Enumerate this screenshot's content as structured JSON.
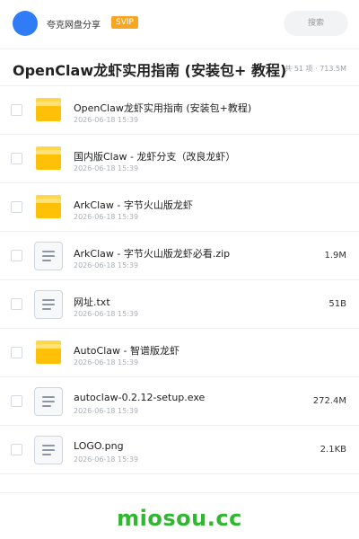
{
  "header": {
    "owner_name": "夸克网盘分享",
    "badge": "SVIP",
    "search_placeholder": "搜索"
  },
  "folder": {
    "title": "OpenClaw龙虾实用指南 (安装包+ 教程)",
    "summary": "共 51 项 · 713.5M"
  },
  "files": [
    {
      "name": "OpenClaw龙虾实用指南 (安装包+教程)",
      "date": "2026-06-18 15:39",
      "size": "",
      "type": "folder",
      "icon": "folder-icon"
    },
    {
      "name": "国内版Claw - 龙虾分支（改良龙虾）",
      "date": "2026-06-18 15:39",
      "size": "",
      "type": "folder",
      "icon": "folder-icon"
    },
    {
      "name": "ArkClaw - 字节火山版龙虾",
      "date": "2026-06-18 15:39",
      "size": "",
      "type": "folder",
      "icon": "folder-icon"
    },
    {
      "name": "ArkClaw - 字节火山版龙虾必看.zip",
      "date": "2026-06-18 15:39",
      "size": "1.9M",
      "type": "file",
      "icon": "file-icon"
    },
    {
      "name": "网址.txt",
      "date": "2026-06-18 15:39",
      "size": "51B",
      "type": "file",
      "icon": "file-icon"
    },
    {
      "name": "AutoClaw - 智谱版龙虾",
      "date": "2026-06-18 15:39",
      "size": "",
      "type": "folder",
      "icon": "folder-icon"
    },
    {
      "name": "autoclaw-0.2.12-setup.exe",
      "date": "2026-06-18 15:39",
      "size": "272.4M",
      "type": "file",
      "icon": "file-icon"
    },
    {
      "name": "LOGO.png",
      "date": "2026-06-18 15:39",
      "size": "2.1KB",
      "type": "file",
      "icon": "file-icon"
    }
  ],
  "watermark": "miosou.cc",
  "colors": {
    "avatar": "#2f7cf6",
    "badge": "#f5a623",
    "folder": "#ffc107",
    "watermark": "#2eb82e"
  }
}
